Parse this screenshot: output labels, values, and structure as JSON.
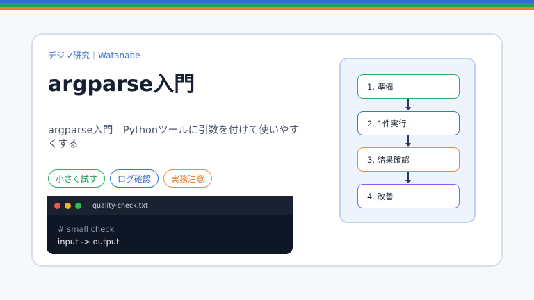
{
  "colors": {
    "stripe_blue": "#2f6fd6",
    "stripe_green": "#21a35a",
    "stripe_orange": "#f07c2a",
    "title": "#172033",
    "accent": "#3b74d1"
  },
  "header": {
    "eyebrow": "デジマ研究｜Watanabe",
    "title": "argparse入門",
    "description": "argparse入門｜Pythonツールに引数を付けて使いやすくする"
  },
  "tags": [
    {
      "label": "小さく試す",
      "color": "green"
    },
    {
      "label": "ログ確認",
      "color": "blue"
    },
    {
      "label": "実務注意",
      "color": "orange"
    }
  ],
  "terminal": {
    "filename": "quality-check.txt",
    "lines": [
      {
        "text": "# small check",
        "kind": "comment"
      },
      {
        "text": "input -> output",
        "kind": "code"
      }
    ]
  },
  "flow": {
    "steps": [
      {
        "label": "1. 準備",
        "color": "green"
      },
      {
        "label": "2. 1件実行",
        "color": "blue"
      },
      {
        "label": "3. 結果確認",
        "color": "orange"
      },
      {
        "label": "4. 改善",
        "color": "purple"
      }
    ]
  }
}
